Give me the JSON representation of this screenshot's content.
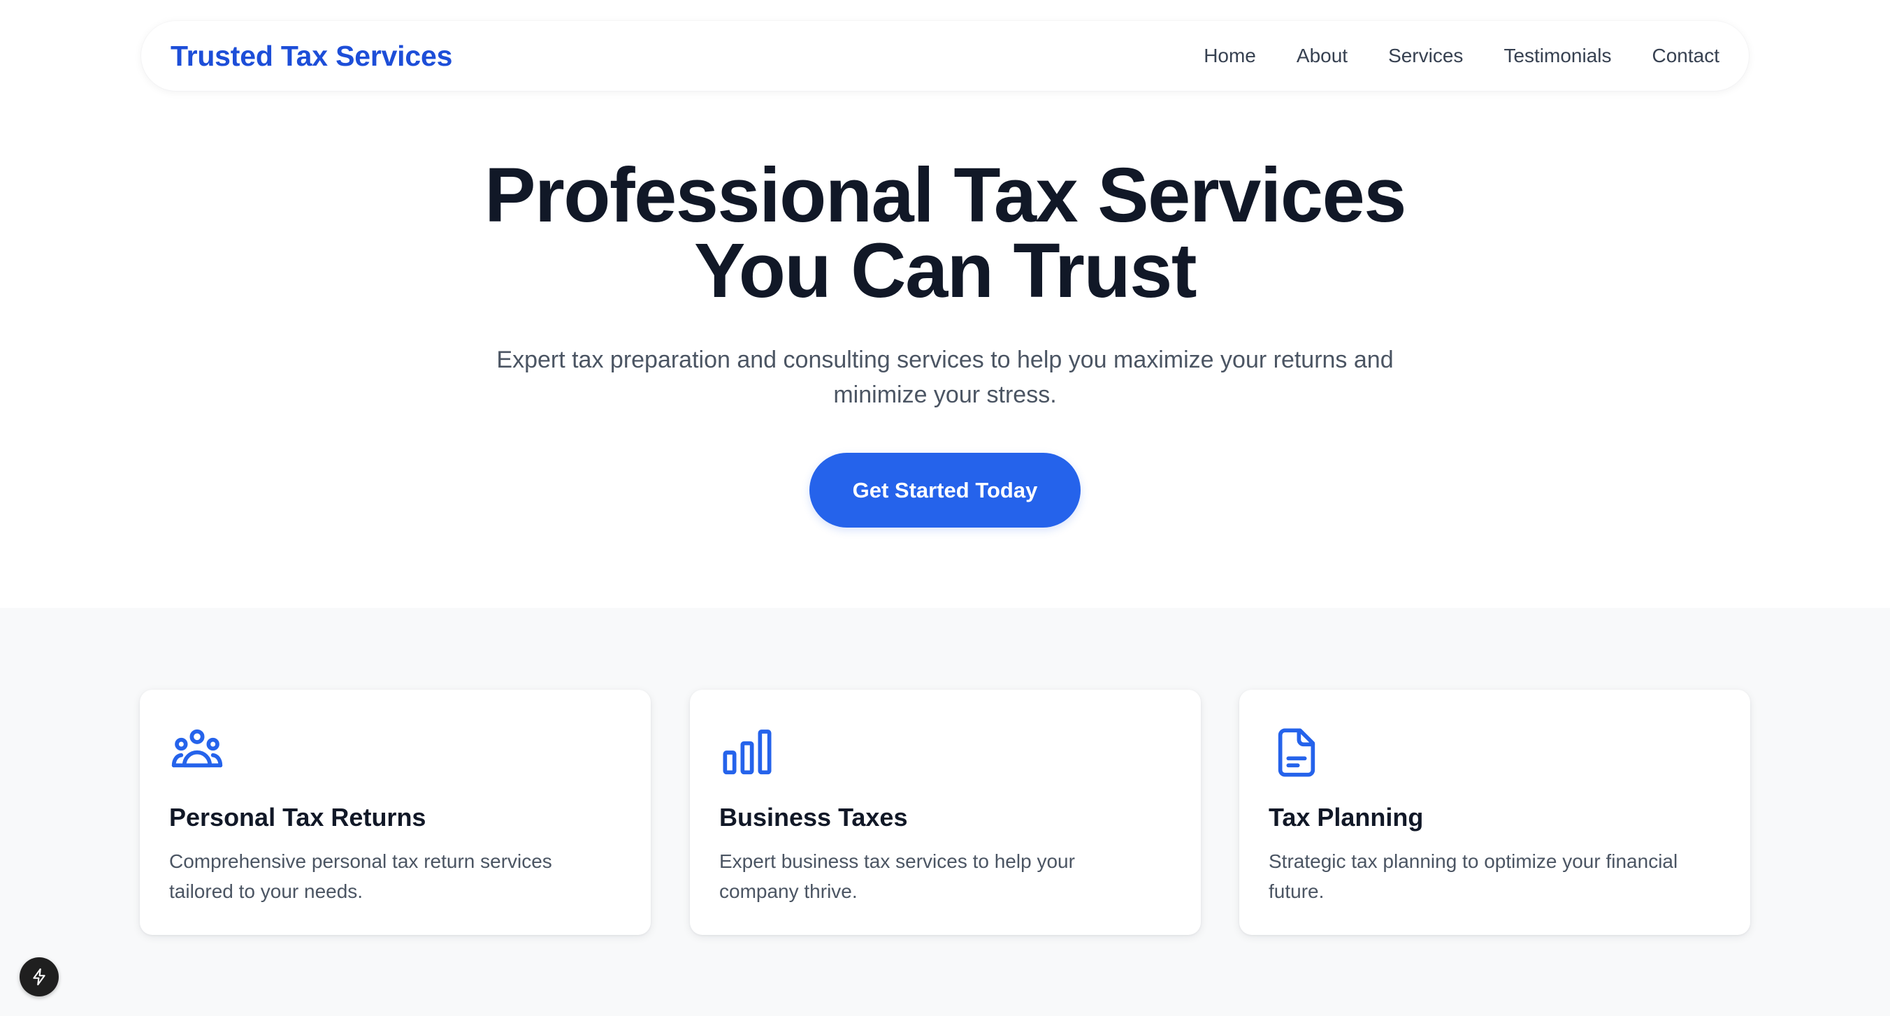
{
  "header": {
    "brand": "Trusted Tax Services",
    "nav": [
      {
        "label": "Home"
      },
      {
        "label": "About"
      },
      {
        "label": "Services"
      },
      {
        "label": "Testimonials"
      },
      {
        "label": "Contact"
      }
    ]
  },
  "hero": {
    "title_line1": "Professional Tax Services",
    "title_line2": "You Can Trust",
    "subtitle": "Expert tax preparation and consulting services to help you maximize your returns and minimize your stress.",
    "cta_label": "Get Started Today"
  },
  "services": {
    "cards": [
      {
        "icon": "users-icon",
        "title": "Personal Tax Returns",
        "description": "Comprehensive personal tax return services tailored to your needs."
      },
      {
        "icon": "bar-chart-icon",
        "title": "Business Taxes",
        "description": "Expert business tax services to help your company thrive."
      },
      {
        "icon": "document-icon",
        "title": "Tax Planning",
        "description": "Strategic tax planning to optimize your financial future."
      }
    ]
  },
  "floating_button": {
    "icon": "lightning-bolt-icon"
  },
  "colors": {
    "brand": "#1d4ed8",
    "accent": "#2563eb",
    "heading": "#111827",
    "body_text": "#4b5563",
    "section_bg": "#f8f9fa"
  }
}
